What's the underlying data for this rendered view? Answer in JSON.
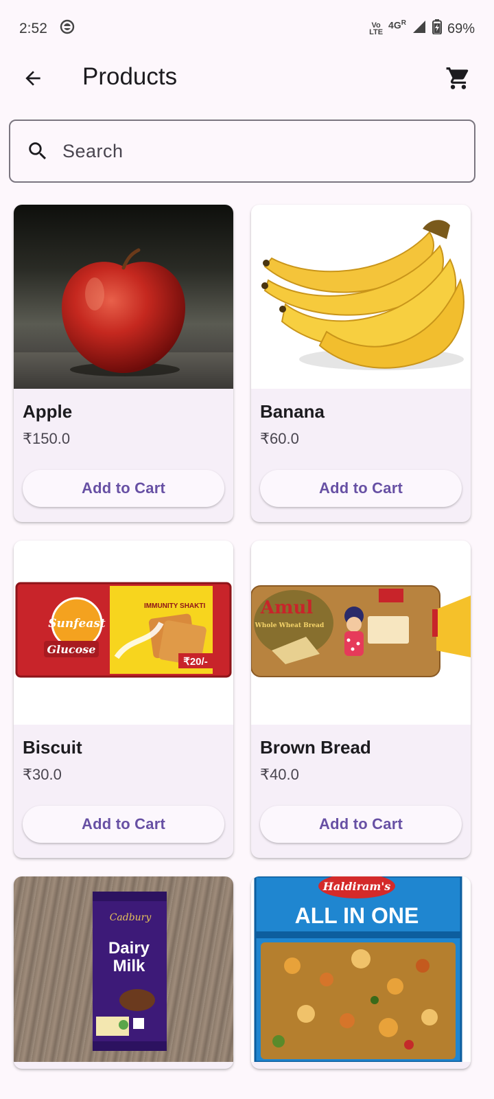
{
  "status": {
    "time": "2:52",
    "volte": "Vo\nLTE",
    "network": "4G",
    "roaming": "R",
    "battery": "69%"
  },
  "header": {
    "title": "Products"
  },
  "search": {
    "placeholder": "Search"
  },
  "products": [
    {
      "name": "Apple",
      "price": "₹150.0",
      "button": "Add to Cart"
    },
    {
      "name": "Banana",
      "price": "₹60.0",
      "button": "Add to Cart"
    },
    {
      "name": "Biscuit",
      "price": "₹30.0",
      "button": "Add to Cart"
    },
    {
      "name": "Brown Bread",
      "price": "₹40.0",
      "button": "Add to Cart"
    },
    {
      "name": "",
      "price": "",
      "button": ""
    },
    {
      "name": "",
      "price": "",
      "button": ""
    }
  ],
  "package_text": {
    "biscuit_brand": "Sunfeast",
    "biscuit_sub": "Glucose",
    "biscuit_tag": "IMMUNITY SHAKTI",
    "biscuit_price": "₹20/-",
    "bread_brand": "Amul",
    "bread_sub": "Whole Wheat Bread",
    "choc_brand": "Cadbury",
    "choc_name": "Dairy Milk",
    "snack_brand": "Haldiram's",
    "snack_name": "ALL IN ONE"
  },
  "colors": {
    "accent": "#6750a4",
    "background": "#fdf7fc",
    "card": "#f6eff8"
  }
}
